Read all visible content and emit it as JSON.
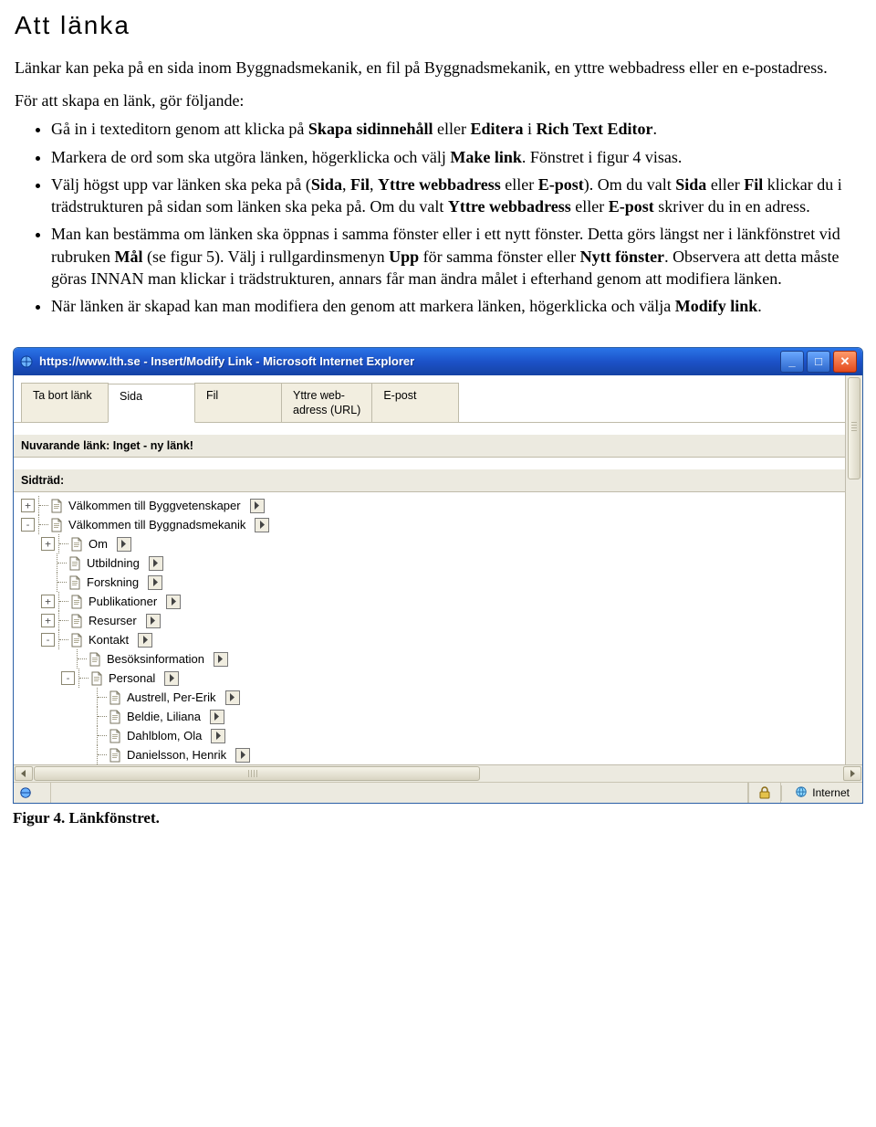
{
  "heading": "Att länka",
  "intro": "Länkar kan peka på en sida inom Byggnadsmekanik, en fil på Byggnadsmekanik, en yttre webbadress eller en e-postadress.",
  "lead": "För att skapa en länk, gör följande:",
  "bullets": {
    "b1_a": "Gå in i texteditorn genom att klicka på ",
    "b1_b": "Skapa sidinnehåll",
    "b1_c": " eller ",
    "b1_d": "Editera",
    "b1_e": " i ",
    "b1_f": "Rich Text Editor",
    "b1_g": ".",
    "b2_a": "Markera de ord som ska utgöra länken, högerklicka och välj ",
    "b2_b": "Make link",
    "b2_c": ". Fönstret i figur 4 visas.",
    "b3_a": "Välj högst upp var länken ska peka på (",
    "b3_b": "Sida",
    "b3_c": ", ",
    "b3_d": "Fil",
    "b3_e": ", ",
    "b3_f": "Yttre webbadress",
    "b3_g": " eller ",
    "b3_h": "E-post",
    "b3_i": "). Om du valt ",
    "b3_j": "Sida",
    "b3_k": " eller ",
    "b3_l": "Fil",
    "b3_m": " klickar du i trädstrukturen på sidan som länken ska peka på. Om du valt ",
    "b3_n": "Yttre webbadress",
    "b3_o": " eller ",
    "b3_p": "E-post",
    "b3_q": " skriver du in en adress.",
    "b4_a": "Man kan bestämma om länken ska öppnas i samma fönster eller i ett nytt fönster. Detta görs längst ner i länkfönstret vid rubruken ",
    "b4_b": "Mål",
    "b4_c": " (se figur 5). Välj i rullgardinsmenyn ",
    "b4_d": "Upp",
    "b4_e": " för samma fönster eller ",
    "b4_f": "Nytt fönster",
    "b4_g": ". Observera att detta måste göras INNAN man klickar i trädstrukturen, annars får man ändra målet i efterhand genom att modifiera länken.",
    "b5_a": "När länken är skapad kan man modifiera den genom att markera länken, högerklicka och välja ",
    "b5_b": "Modify link",
    "b5_c": "."
  },
  "window": {
    "title": "https://www.lth.se - Insert/Modify Link - Microsoft Internet Explorer",
    "tabs": {
      "remove": "Ta bort länk",
      "sida": "Sida",
      "fil": "Fil",
      "yttre_l1": "Yttre web-",
      "yttre_l2": "adress (URL)",
      "epost": "E-post"
    },
    "currentLink": "Nuvarande länk: Inget - ny länk!",
    "sidtrad": "Sidträd:",
    "tree": [
      {
        "depth": 0,
        "exp": "+",
        "label": "Välkommen till Byggvetenskaper"
      },
      {
        "depth": 0,
        "exp": "-",
        "label": "Välkommen till Byggnadsmekanik"
      },
      {
        "depth": 1,
        "exp": "+",
        "label": "Om"
      },
      {
        "depth": 1,
        "exp": "",
        "label": "Utbildning"
      },
      {
        "depth": 1,
        "exp": "",
        "label": "Forskning"
      },
      {
        "depth": 1,
        "exp": "+",
        "label": "Publikationer"
      },
      {
        "depth": 1,
        "exp": "+",
        "label": "Resurser"
      },
      {
        "depth": 1,
        "exp": "-",
        "label": "Kontakt"
      },
      {
        "depth": 2,
        "exp": "",
        "label": "Besöksinformation"
      },
      {
        "depth": 2,
        "exp": "-",
        "label": "Personal"
      },
      {
        "depth": 3,
        "exp": "",
        "label": "Austrell, Per-Erik"
      },
      {
        "depth": 3,
        "exp": "",
        "label": "Beldie, Liliana"
      },
      {
        "depth": 3,
        "exp": "",
        "label": "Dahlblom, Ola"
      },
      {
        "depth": 3,
        "exp": "",
        "label": "Danielsson, Henrik"
      }
    ],
    "status": {
      "zone": "Internet"
    }
  },
  "caption_a": "Figur 4. Länkfönstret."
}
